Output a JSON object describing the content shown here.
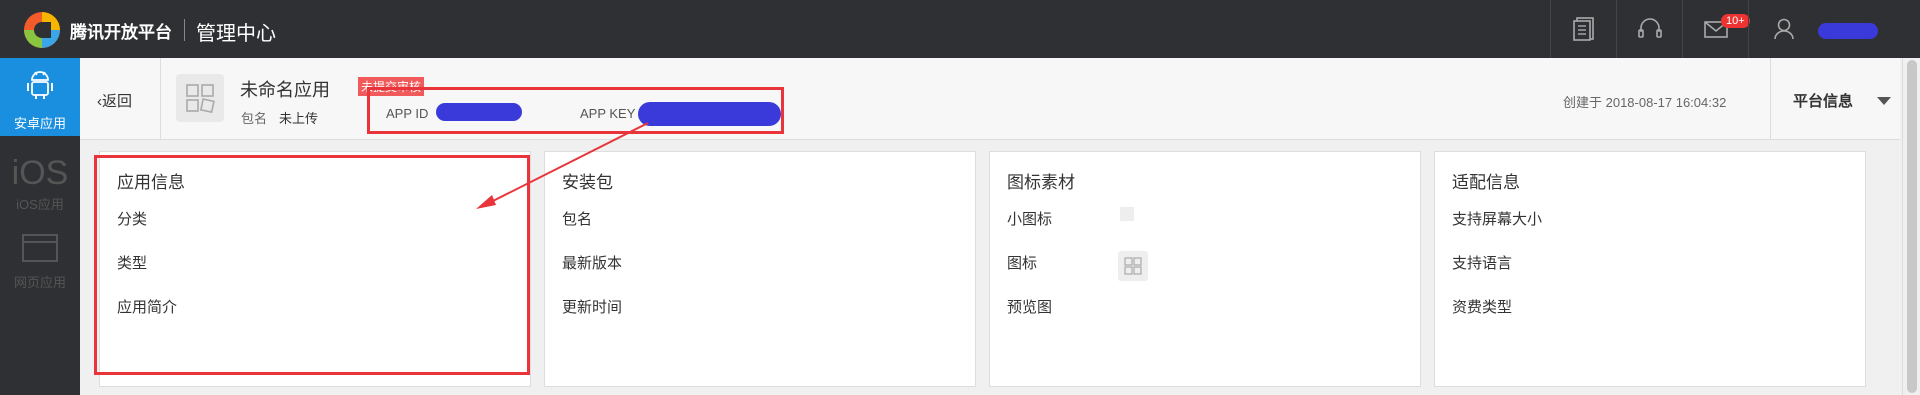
{
  "topbar": {
    "brand": "腾讯开放平台",
    "title": "管理中心",
    "icons": [
      "document-icon",
      "headset-icon",
      "mail-icon",
      "user-icon"
    ],
    "mail_badge": "10+"
  },
  "leftnav": {
    "items": [
      {
        "label": "安卓应用",
        "icon": "android-icon",
        "active": true
      },
      {
        "label": "iOS应用",
        "icon": "ios-text-icon",
        "active": false
      },
      {
        "label": "网页应用",
        "icon": "webpage-icon",
        "active": false
      }
    ],
    "ios_glyph": "iOS"
  },
  "subheader": {
    "back_label": "返回",
    "app_name": "未命名应用",
    "status_tag": "未提交审核",
    "package_label": "包名",
    "package_value": "未上传",
    "app_id_label": "APP ID",
    "app_key_label": "APP KEY",
    "created": "创建于 2018-08-17 16:04:32",
    "platform_label": "平台信息"
  },
  "cards": [
    {
      "title": "应用信息",
      "rows": [
        "分类",
        "类型",
        "应用简介"
      ]
    },
    {
      "title": "安装包",
      "rows": [
        "包名",
        "最新版本",
        "更新时间"
      ]
    },
    {
      "title": "图标素材",
      "rows": [
        "小图标",
        "图标",
        "预览图"
      ]
    },
    {
      "title": "适配信息",
      "rows": [
        "支持屏幕大小",
        "支持语言",
        "资费类型"
      ]
    }
  ],
  "colors": {
    "topbar_bg": "#2f3033",
    "active_nav": "#1a8fe0",
    "annotation_red": "#e8343a",
    "redaction_blue": "#3a3adb"
  }
}
